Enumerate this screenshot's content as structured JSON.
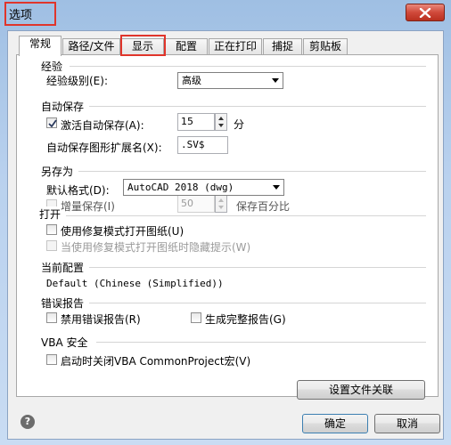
{
  "window": {
    "title": "选项"
  },
  "tabs": [
    "常规",
    "路径/文件",
    "显示",
    "配置",
    "正在打印",
    "捕捉",
    "剪贴板"
  ],
  "experience": {
    "group_title": "经验",
    "level_label": "经验级别(E):",
    "level_value": "高级"
  },
  "autosave": {
    "group_title": "自动保存",
    "activate_label": "激活自动保存(A):",
    "minutes_value": "15",
    "unit": "分",
    "ext_label": "自动保存图形扩展名(X):",
    "ext_value": ".SV$"
  },
  "save_as": {
    "group_title": "另存为",
    "format_label": "默认格式(D):",
    "format_value": "AutoCAD 2018 (dwg)",
    "incremental_label": "增量保存(I)",
    "incremental_value": "50",
    "percent_label": "保存百分比"
  },
  "open": {
    "group_title": "打开",
    "repair_label": "使用修复模式打开图纸(U)",
    "hide_prompt_label": "当使用修复模式打开图纸时隐藏提示(W)"
  },
  "current_profile": {
    "group_title": "当前配置",
    "value": "Default (Chinese (Simplified))"
  },
  "error_report": {
    "group_title": "错误报告",
    "disable_label": "禁用错误报告(R)",
    "full_label": "生成完整报告(G)"
  },
  "vba": {
    "group_title": "VBA 安全",
    "close_label": "启动时关闭VBA CommonProject宏(V)"
  },
  "buttons": {
    "file_assoc": "设置文件关联",
    "ok": "确定",
    "cancel": "取消",
    "help_glyph": "?"
  },
  "icons": {
    "close": "close-icon",
    "help": "help-icon",
    "check": "checkmark-icon"
  },
  "colors": {
    "highlight": "#e0352b",
    "close_button": "#c94030"
  }
}
